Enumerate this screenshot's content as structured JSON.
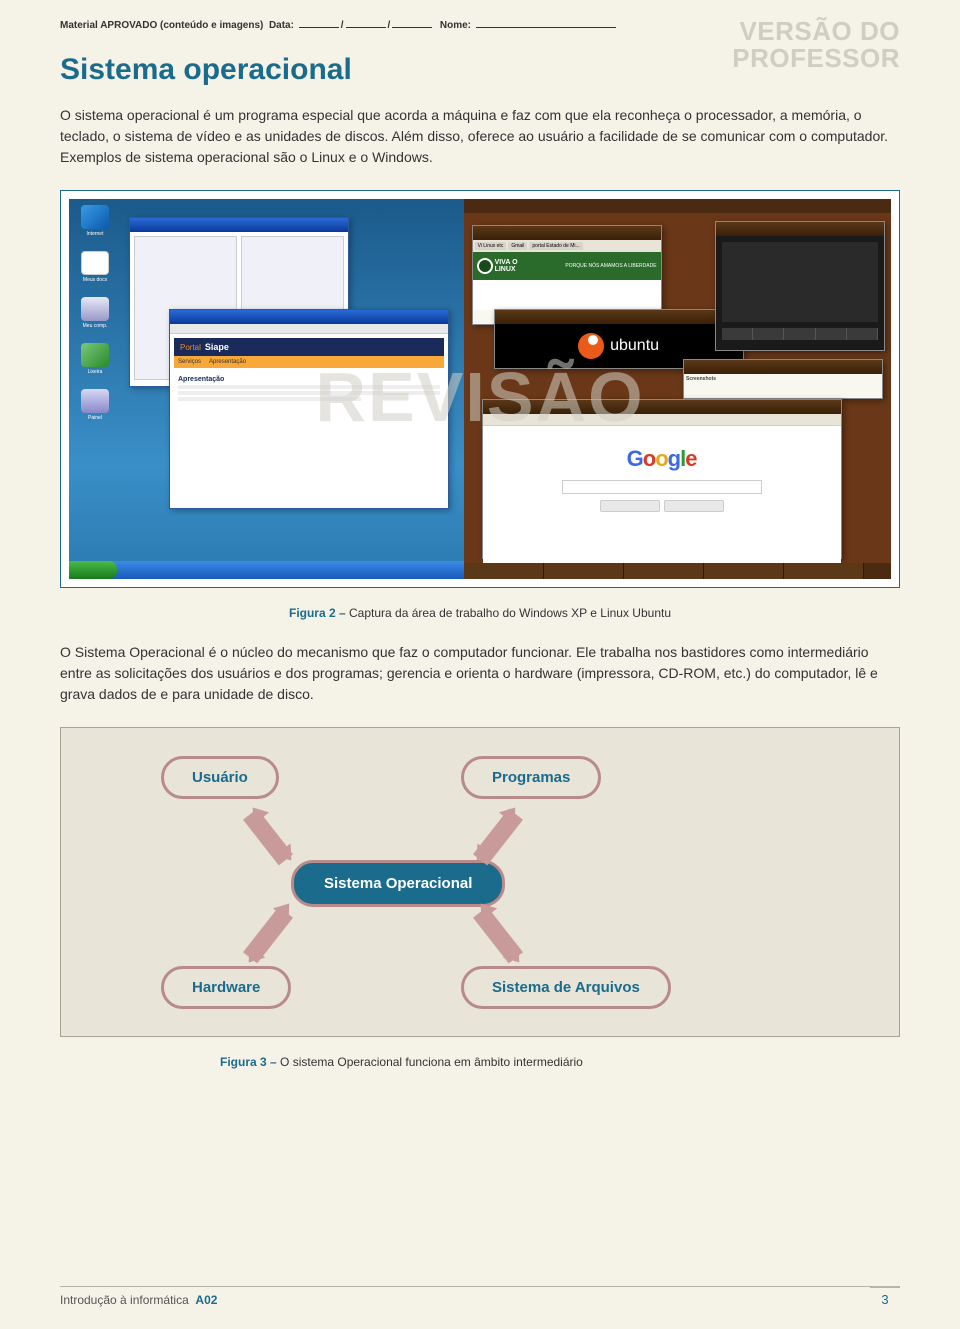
{
  "header": {
    "approval_prefix": "Material APROVADO (conteúdo e imagens)",
    "date_label": "Data:",
    "name_label": "Nome:"
  },
  "watermark": {
    "line1": "VERSÃO DO",
    "line2": "PROFESSOR",
    "center": "REVISÃO"
  },
  "title": "Sistema operacional",
  "intro": "O sistema operacional é um programa especial que acorda a máquina e faz com que ela reconheça o processador, a memória, o teclado, o sistema de vídeo e as unidades de discos. Além disso, oferece ao usuário a facilidade de se comunicar com o computador. Exemplos de sistema operacional são o Linux e o Windows.",
  "figure2": {
    "label": "Figura 2 –",
    "text": "Captura da área de trabalho do Windows XP e Linux Ubuntu"
  },
  "xp": {
    "icons": [
      "Internet",
      "Meus docs",
      "Meu comp.",
      "Lixeira",
      "Painel"
    ],
    "siape_portal": "Portal",
    "siape_brand": "Siape",
    "siape_menu": [
      "Serviços",
      "Apresentação"
    ],
    "siape_section": "Apresentação"
  },
  "ubuntu": {
    "tabs": [
      "Vi Linux etc",
      "Gmail",
      "portal Estado de Mi..."
    ],
    "vivao": "VIVA O",
    "linux": "LINUX",
    "slogan": "PORQUE NÓS AMAMOS A LIBERDADE",
    "brand": "ubuntu",
    "screenshots": "Screenshots",
    "google": [
      "G",
      "o",
      "o",
      "g",
      "l",
      "e"
    ]
  },
  "body2": "O Sistema Operacional é o núcleo do mecanismo que faz o computador funcionar. Ele trabalha nos bastidores como intermediário entre as solicitações dos usuários e dos programas; gerencia e orienta o hardware (impressora, CD-ROM, etc.) do computador, lê e grava dados de e para unidade de disco.",
  "diagram": {
    "user": "Usuário",
    "programs": "Programas",
    "os": "Sistema Operacional",
    "hardware": "Hardware",
    "filesystem": "Sistema de Arquivos"
  },
  "figure3": {
    "label": "Figura 3 –",
    "text": "O sistema Operacional funciona em âmbito intermediário"
  },
  "footer": {
    "course": "Introdução à informática",
    "code": "A02",
    "page": "3"
  }
}
